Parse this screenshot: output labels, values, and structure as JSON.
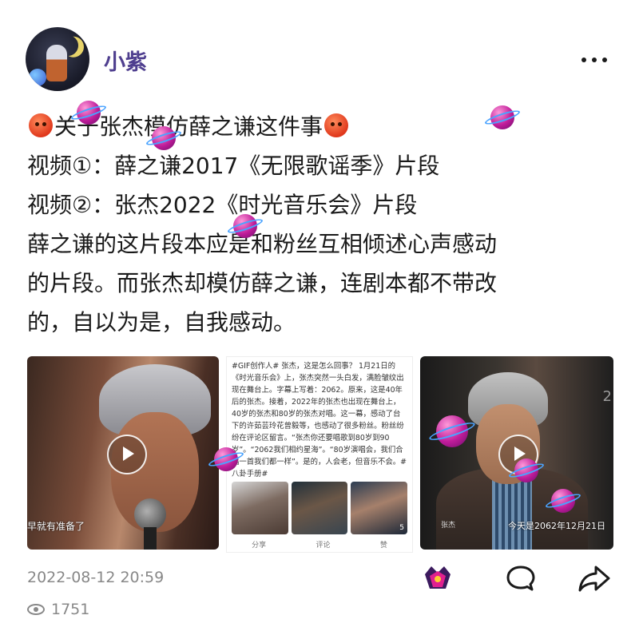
{
  "header": {
    "username": "小紫",
    "more_label": "···"
  },
  "post": {
    "lines": [
      {
        "before_emoji": "",
        "text": "关于张杰模仿薛之谦这件事",
        "after_emoji": ""
      },
      {
        "text": "视频①：薛之谦2017《无限歌谣季》片段"
      },
      {
        "text": "视频②：张杰2022《时光音乐会》片段"
      },
      {
        "text": "薛之谦的这片段本应是和粉丝互相倾述心声感动"
      },
      {
        "text": "的片段。而张杰却模仿薛之谦，连剧本都不带改"
      },
      {
        "text": "的，自以为是，自我感动。"
      }
    ]
  },
  "media": {
    "image1": {
      "caption": "早就有准备了"
    },
    "image2": {
      "text": "#GIF创作人# 张杰，这是怎么回事？ 1月21日的《时光音乐会》上，张杰突然一头白发，满脸皱纹出现在舞台上。字幕上写着：2062。原来，这是40年后的张杰。接着，2022年的张杰也出现在舞台上，40岁的张杰和80岁的张杰对唱。这一幕，感动了台下的许茹芸玲花曾毅等，也感动了很多粉丝。粉丝纷纷在评论区留言。“张杰你还要唱歌到80岁到90岁”。“2062我们相约星海”。“80岁演唱会，我们合唱一首我们都一样”。是的，人会老，但音乐不会。#八卦手册#",
      "count": "5",
      "actions": [
        "分享",
        "评论",
        "赞"
      ]
    },
    "image3": {
      "name_tag": "张杰",
      "subtitle": "今天是2062年12月21日",
      "corner_number": "2"
    }
  },
  "footer": {
    "timestamp": "2022-08-12 20:59",
    "views": "1751"
  },
  "colors": {
    "username": "#4f3f8f",
    "meta_text": "#888888",
    "body_text": "#1a1a1a"
  }
}
